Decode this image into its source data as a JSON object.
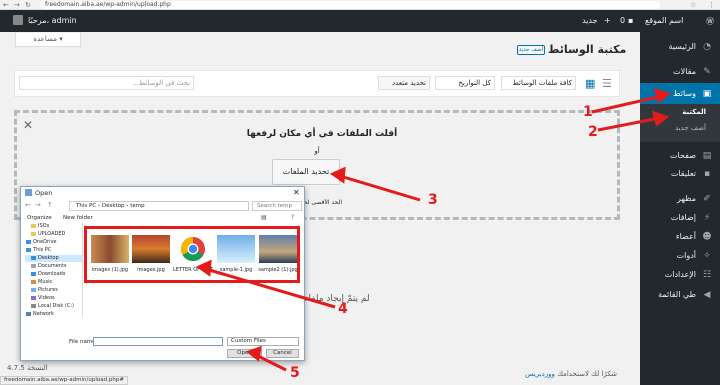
{
  "browser": {
    "url": "freedomain.aiba.ae/wp-admin/upload.php"
  },
  "adminbar": {
    "site_name": "اسم الموقع",
    "comments_count": "0",
    "new_label": "جديد",
    "greeting": "مرحبًا، admin"
  },
  "help_tab": "مساعدة",
  "sidebar": {
    "items": [
      {
        "label": "الرئيسية",
        "icon": "dashboard-icon"
      },
      {
        "label": "مقالات",
        "icon": "pin-icon"
      },
      {
        "label": "وسائط",
        "icon": "media-icon"
      },
      {
        "label": "صفحات",
        "icon": "page-icon"
      },
      {
        "label": "تعليقات",
        "icon": "comment-icon"
      },
      {
        "label": "مظهر",
        "icon": "brush-icon"
      },
      {
        "label": "إضافات",
        "icon": "plugin-icon"
      },
      {
        "label": "أعضاء",
        "icon": "users-icon"
      },
      {
        "label": "أدوات",
        "icon": "wrench-icon"
      },
      {
        "label": "الإعدادات",
        "icon": "settings-icon"
      },
      {
        "label": "طي القائمة",
        "icon": "collapse-icon"
      }
    ],
    "submenu": [
      "المكتبة",
      "أضف جديد"
    ]
  },
  "header": {
    "title": "مكتبة الوسائط",
    "add_new": "أضف جديد"
  },
  "filters": {
    "media_type": "كافة ملفات الوسائط",
    "dates": "كل التواريخ",
    "bulk_select": "تحديد متعدد",
    "search_placeholder": "بحث في الوسائط..."
  },
  "uploader": {
    "drop_text": "أفلت الملفات في أي مكان لرفعها",
    "or_text": "أو",
    "select_button": "تحديد الملفات",
    "max_size": "الحد الأقصى لحجم الملف",
    "no_media": "لم يتمّ إيجاد ملفات"
  },
  "dialog": {
    "title": "Open",
    "path": [
      "This PC",
      "Desktop",
      "temp"
    ],
    "search_placeholder": "Search temp",
    "organize": "Organize",
    "new_folder": "New folder",
    "tree": [
      "ISOs",
      "UPLOADED",
      "OneDrive",
      "This PC",
      "Desktop",
      "Documents",
      "Downloads",
      "Music",
      "Pictures",
      "Videos",
      "Local Disk (C:)",
      "Network"
    ],
    "files": [
      "images (1).jpg",
      "images.jpg",
      "LETTER OF INSTRUCTI...",
      "sample-1.jpg",
      "sample2 (1).jpg"
    ],
    "filename_label": "File name:",
    "filter": "Custom Files",
    "open_button": "Open",
    "cancel_button": "Cancel"
  },
  "footer": {
    "version": "النسخة 4.7.5",
    "thanks": "شكرًا لك لاستخدامك",
    "thanks_link": "ووردبريس",
    "status_url": "freedomain.aiba.ae/wp-admin/upload.php#"
  },
  "annotations": [
    "1",
    "2",
    "3",
    "4",
    "5"
  ],
  "colors": {
    "admin_bg": "#23282d",
    "active_blue": "#0073aa",
    "arrow_red": "#e31b1b"
  }
}
